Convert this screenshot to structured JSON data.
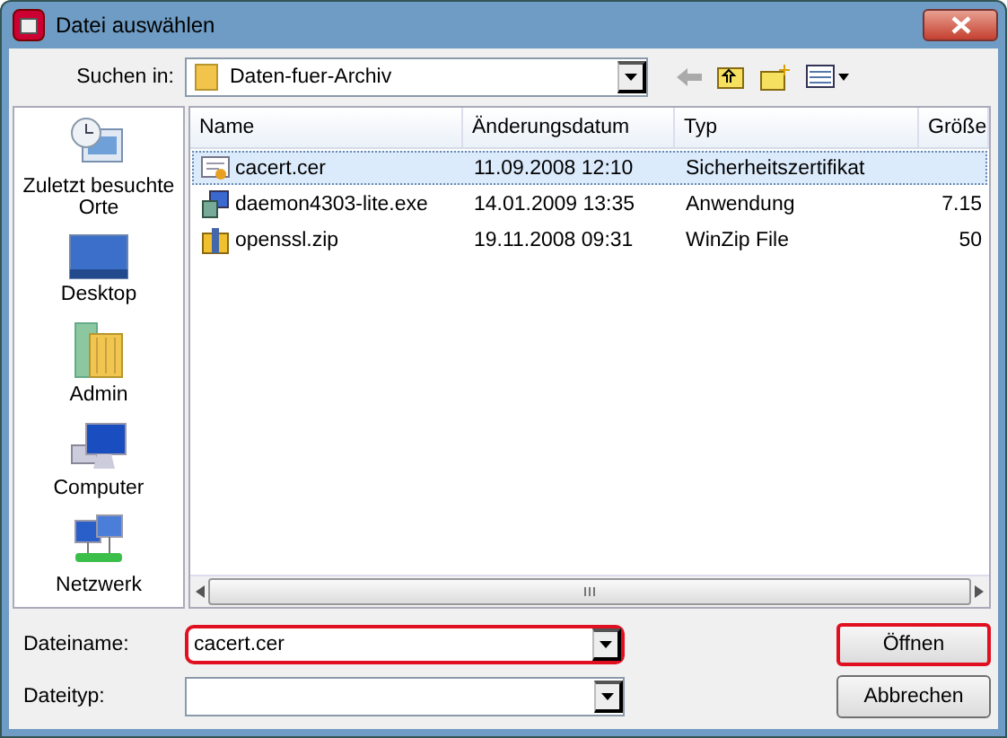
{
  "window": {
    "title": "Datei auswählen"
  },
  "look_in": {
    "label": "Suchen in:",
    "value": "Daten-fuer-Archiv"
  },
  "places": [
    {
      "label": "Zuletzt besuchte Orte",
      "kind": "recent"
    },
    {
      "label": "Desktop",
      "kind": "desktop"
    },
    {
      "label": "Admin",
      "kind": "user"
    },
    {
      "label": "Computer",
      "kind": "computer"
    },
    {
      "label": "Netzwerk",
      "kind": "network"
    }
  ],
  "table": {
    "columns": [
      "Name",
      "Änderungsdatum",
      "Typ",
      "Größe"
    ],
    "rows": [
      {
        "name": "cacert.cer",
        "date": "11.09.2008 12:10",
        "type": "Sicherheitszertifikat",
        "kind": "cert",
        "selected": true
      },
      {
        "name": "daemon4303-lite.exe",
        "date": "14.01.2009 13:35",
        "type": "Anwendung",
        "size": "7.15",
        "kind": "exe",
        "selected": false
      },
      {
        "name": "openssl.zip",
        "date": "19.11.2008 09:31",
        "type": "WinZip File",
        "size": "50",
        "kind": "zip",
        "selected": false
      }
    ]
  },
  "filename": {
    "label": "Dateiname:",
    "value": "cacert.cer",
    "highlighted": true
  },
  "filetype": {
    "label": "Dateityp:",
    "highlighted": false
  },
  "buttons": [
    {
      "label": "Öffnen",
      "highlighted": true
    },
    {
      "label": "Abbrechen",
      "highlighted": false
    }
  ]
}
